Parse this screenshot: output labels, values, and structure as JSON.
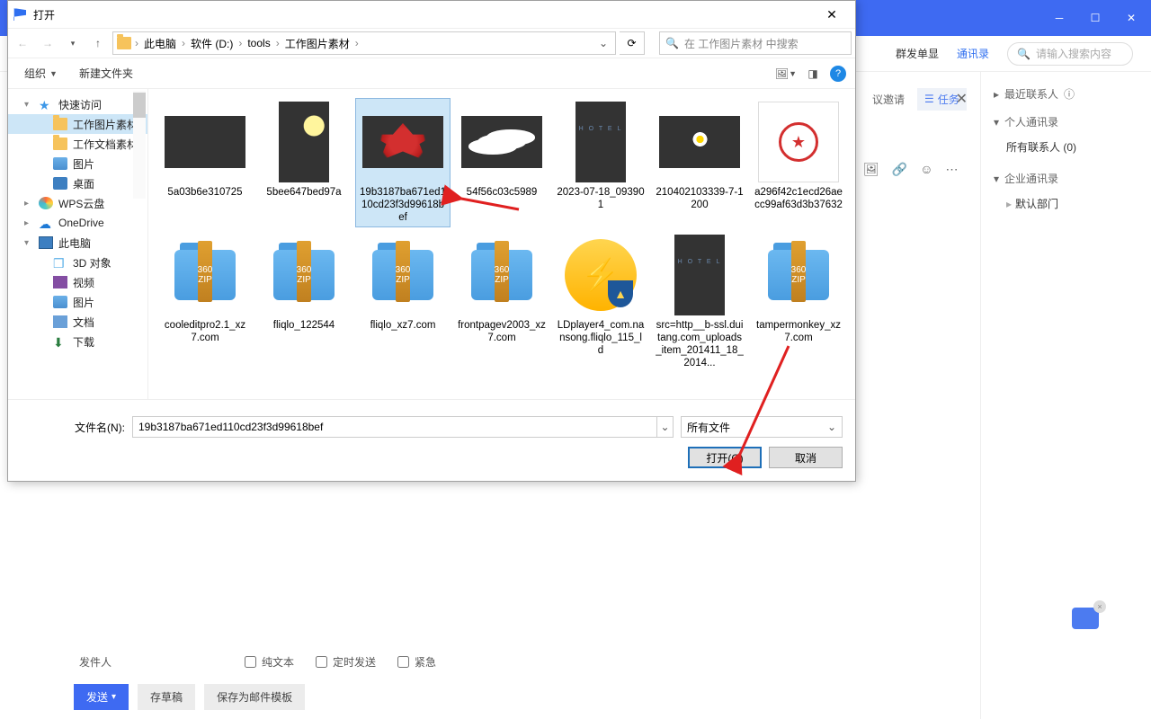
{
  "app": {
    "subbar": {
      "link1": "群发单显",
      "link2": "通讯录",
      "search_placeholder": "请输入搜索内容"
    },
    "midtabs": {
      "invite": "议邀请",
      "task": "任务"
    },
    "rightside": {
      "recent": {
        "label": "最近联系人"
      },
      "personal": {
        "label": "个人通讯录",
        "sub": "所有联系人  (0)"
      },
      "corp": {
        "label": "企业通讯录",
        "sub": "默认部门"
      }
    },
    "sender": {
      "label": "发件人",
      "plain": "纯文本",
      "timed": "定时发送",
      "urgent": "紧急"
    },
    "btn": {
      "send": "发送",
      "draft": "存草稿",
      "template": "保存为邮件模板"
    }
  },
  "dlg": {
    "title": "打开",
    "path": [
      "此电脑",
      "软件 (D:)",
      "tools",
      "工作图片素材"
    ],
    "search_placeholder": "在 工作图片素材 中搜索",
    "org": "组织",
    "newf": "新建文件夹",
    "tree": [
      {
        "l": "快速访问",
        "lv": 1,
        "caret": "▾",
        "ic": "star"
      },
      {
        "l": "工作图片素材",
        "lv": 2,
        "ic": "folder-y",
        "sel": true
      },
      {
        "l": "工作文档素材",
        "lv": 2,
        "ic": "folder-y"
      },
      {
        "l": "图片",
        "lv": 2,
        "ic": "pic"
      },
      {
        "l": "桌面",
        "lv": 2,
        "ic": "desk"
      },
      {
        "l": "WPS云盘",
        "lv": 1,
        "caret": "▸",
        "ic": "wps"
      },
      {
        "l": "OneDrive",
        "lv": 1,
        "caret": "▸",
        "ic": "od"
      },
      {
        "l": "此电脑",
        "lv": 1,
        "caret": "▾",
        "ic": "pc"
      },
      {
        "l": "3D 对象",
        "lv": 2,
        "ic": "cube"
      },
      {
        "l": "视频",
        "lv": 2,
        "ic": "vid"
      },
      {
        "l": "图片",
        "lv": 2,
        "ic": "pic"
      },
      {
        "l": "文档",
        "lv": 2,
        "ic": "doc"
      },
      {
        "l": "下载",
        "lv": 2,
        "ic": "dl"
      }
    ],
    "files": [
      {
        "n": "5a03b6e310725",
        "t": "img",
        "cls": "th-autumn",
        "short": true
      },
      {
        "n": "5bee647bed97a",
        "t": "img",
        "cls": "th-trees"
      },
      {
        "n": "19b3187ba671ed110cd23f3d99618bef",
        "t": "img",
        "cls": "th-maple",
        "sel": true,
        "short": true
      },
      {
        "n": "54f56c03c5989",
        "t": "img",
        "cls": "th-cloud",
        "short": true
      },
      {
        "n": "2023-07-18_093901",
        "t": "img",
        "cls": "th-night"
      },
      {
        "n": "210402103339-7-1200",
        "t": "img",
        "cls": "th-daisy",
        "short": true
      },
      {
        "n": "a296f42c1ecd26aecc99af63d3b37632",
        "t": "stamp"
      },
      {
        "n": "cooleditpro2.1_xz7.com",
        "t": "zip"
      },
      {
        "n": "fliqlo_122544",
        "t": "zip"
      },
      {
        "n": "fliqlo_xz7.com",
        "t": "zip"
      },
      {
        "n": "frontpagev2003_xz7.com",
        "t": "zip"
      },
      {
        "n": "LDplayer4_com.nansong.fliqlo_115_ld",
        "t": "ld"
      },
      {
        "n": "src=http__b-ssl.duitang.com_uploads_item_201411_18_2014...",
        "t": "img",
        "cls": "th-night"
      },
      {
        "n": "tampermonkey_xz7.com",
        "t": "zip"
      }
    ],
    "filename_label": "文件名(N):",
    "filename_value": "19b3187ba671ed110cd23f3d99618bef",
    "filter": "所有文件",
    "open": "打开(O)",
    "cancel": "取消"
  }
}
